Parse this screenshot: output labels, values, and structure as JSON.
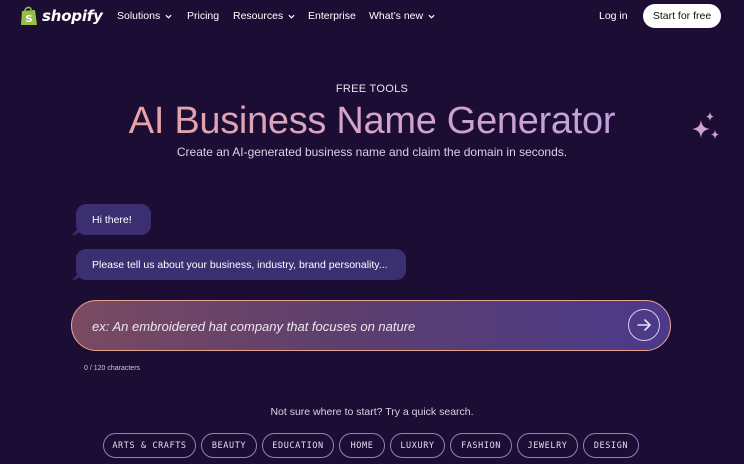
{
  "nav": {
    "logo_text": "shopify",
    "items": [
      {
        "label": "Solutions",
        "has_dropdown": true
      },
      {
        "label": "Pricing",
        "has_dropdown": false
      },
      {
        "label": "Resources",
        "has_dropdown": true
      },
      {
        "label": "Enterprise",
        "has_dropdown": false
      },
      {
        "label": "What’s new",
        "has_dropdown": true
      }
    ],
    "login_label": "Log in",
    "cta_label": "Start for free"
  },
  "hero": {
    "eyebrow": "FREE TOOLS",
    "title": "AI Business Name Generator",
    "subtitle": "Create an AI-generated business name and claim the domain in seconds."
  },
  "chat": {
    "messages": [
      "Hi there!",
      "Please tell us about your business, industry, brand personality..."
    ]
  },
  "prompt": {
    "placeholder": "ex: An embroidered hat company that focuses on nature",
    "value": "",
    "char_count": "0 / 120 characters"
  },
  "quick_search": {
    "hint": "Not sure where to start? Try a quick search.",
    "chips": [
      "ARTS & CRAFTS",
      "BEAUTY",
      "EDUCATION",
      "HOME",
      "LUXURY",
      "FASHION",
      "JEWELRY",
      "DESIGN"
    ]
  },
  "icons": {
    "logo": "shopify-bag-icon",
    "dropdown": "chevron-down-icon",
    "sparkle": "sparkle-icon",
    "send": "arrow-right-icon"
  },
  "colors": {
    "background": "#1b0d33",
    "bubble": "#3b2f72",
    "cta_bg": "#ffffff",
    "input_border": "#e8a58f",
    "title_gradient_start": "#f1a28e",
    "title_gradient_end": "#b6a0e6",
    "logo_green": "#95bf47"
  }
}
